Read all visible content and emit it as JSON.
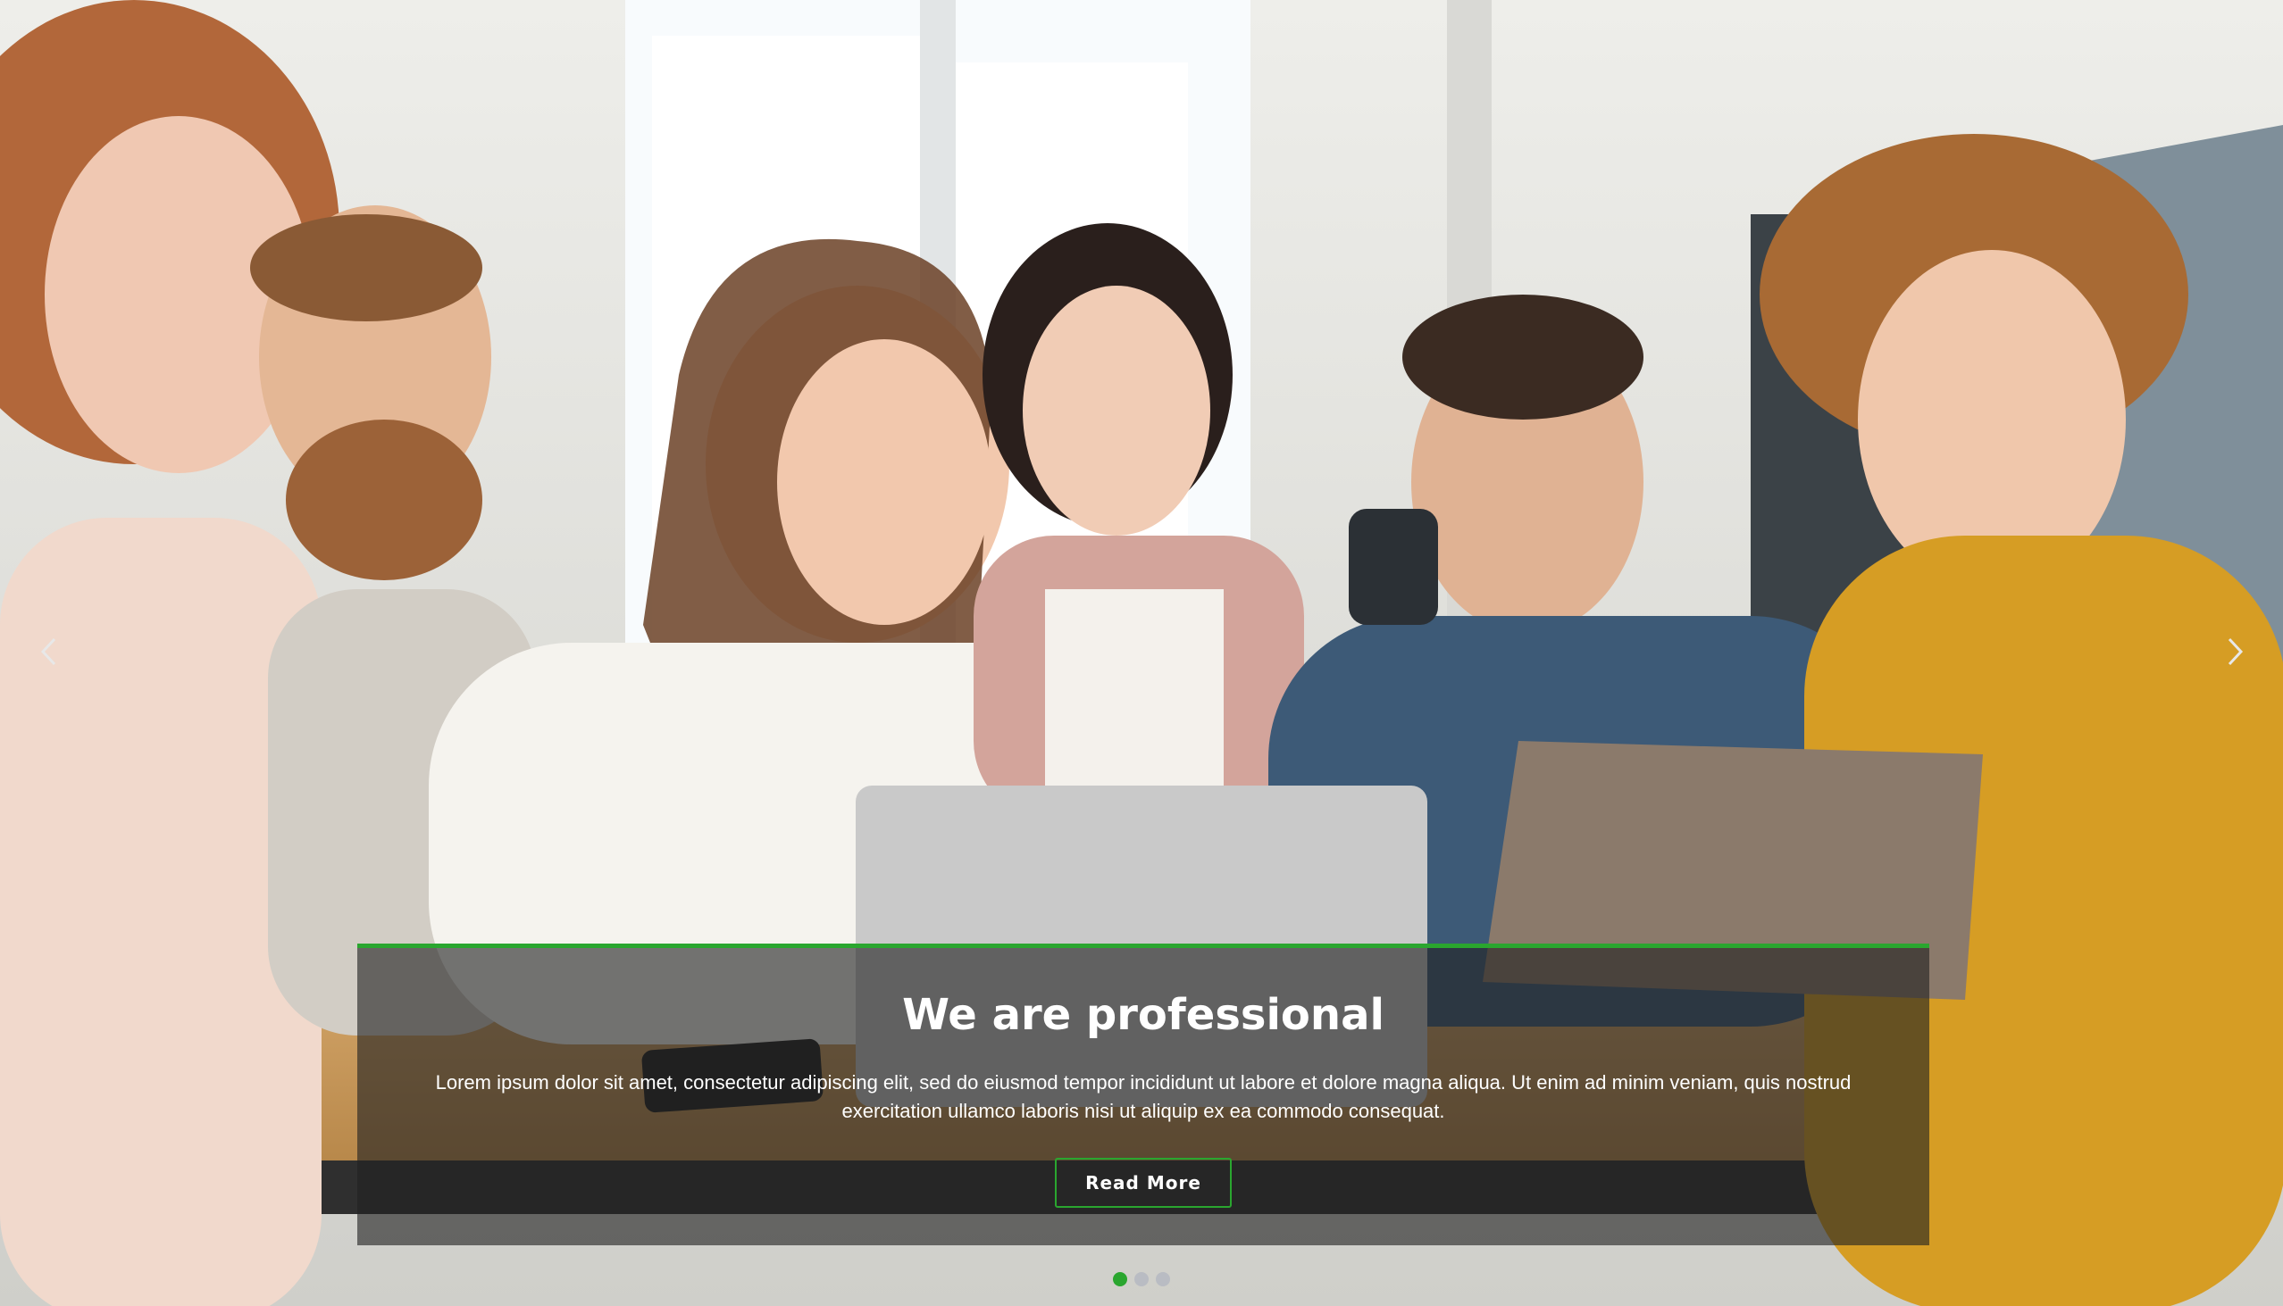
{
  "slider": {
    "caption": {
      "title": "We are professional",
      "text": "Lorem ipsum dolor sit amet, consectetur adipiscing elit, sed do eiusmod tempor incididunt ut labore et dolore magna aliqua. Ut enim ad minim veniam, quis nostrud exercitation ullamco laboris nisi ut aliquip ex ea commodo consequat.",
      "button_label": "Read More"
    },
    "prev_icon": "chevron-left-icon",
    "next_icon": "chevron-right-icon",
    "slide_count": 3,
    "active_slide": 1
  },
  "colors": {
    "accent": "#2aa62f",
    "caption_background": "rgba(34,34,34,0.62)",
    "dot_inactive": "#b9bcc3",
    "text": "#ffffff"
  }
}
